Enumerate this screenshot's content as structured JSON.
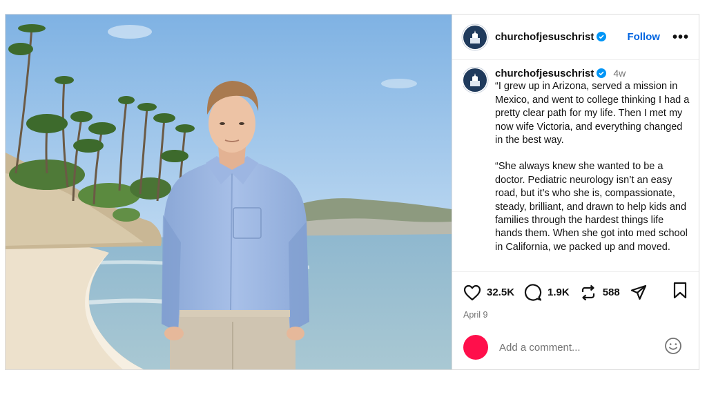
{
  "account": {
    "handle": "churchofjesuschrist",
    "follow_label": "Follow",
    "more_label": "•••"
  },
  "caption": {
    "handle": "churchofjesuschrist",
    "time": "4w",
    "paragraphs": [
      "“I grew up in Arizona, served a mission in Mexico, and went to college thinking I had a pretty clear path for my life. Then I met my now wife Victoria, and everything changed in the best way.",
      "“She always knew she wanted to be a doctor. Pediatric neurology isn’t an easy road, but it’s who she is, compassionate, steady, brilliant, and drawn to help kids and families through the hardest things life hands them. When she got into med school in California, we packed up and moved."
    ]
  },
  "actions": {
    "likes": "32.5K",
    "comments": "1.9K",
    "reposts": "588"
  },
  "date": "April 9",
  "comment": {
    "placeholder": "Add a comment..."
  },
  "colors": {
    "accent": "#0064e0",
    "verified": "#0095f6",
    "user_avatar": "#ff0f4b"
  },
  "icons": [
    "verified-badge-icon",
    "heart-icon",
    "comment-icon",
    "repost-icon",
    "share-icon",
    "bookmark-icon",
    "emoji-icon"
  ]
}
